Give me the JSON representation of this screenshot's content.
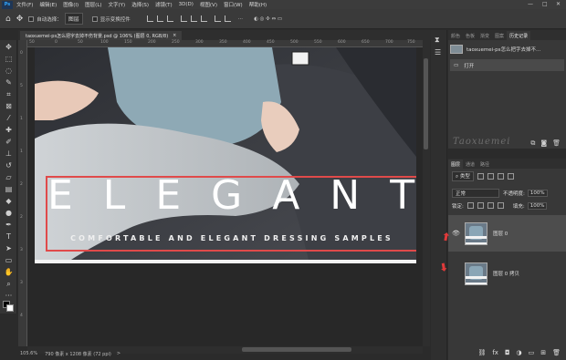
{
  "menubar": {
    "logo": "Ps",
    "items": [
      "文件(F)",
      "编辑(E)",
      "图像(I)",
      "图层(L)",
      "文字(Y)",
      "选择(S)",
      "滤镜(T)",
      "3D(D)",
      "视图(V)",
      "窗口(W)",
      "帮助(H)"
    ],
    "minimize": "—",
    "restore": "□",
    "close": "✕"
  },
  "options": {
    "auto_select_label": "自动选择：",
    "auto_select_value": "图层",
    "show_transform_label": "显示变换控件",
    "more": "···"
  },
  "document": {
    "tab_label": "taoxuemei-ps怎么把字去掉不伤背景.psd @ 106% (图层 0, RGB/8)",
    "close": "×",
    "title_text": "ELEGANT",
    "subtitle_text": "COMFORTABLE AND ELEGANT DRESSING SAMPLES"
  },
  "ruler": {
    "top_ticks": [
      "50",
      "0",
      "50",
      "100",
      "150",
      "200",
      "250",
      "300",
      "350",
      "400",
      "450",
      "500",
      "550",
      "600",
      "650",
      "700",
      "750"
    ],
    "left_ticks": [
      "0",
      "5",
      "1",
      "1",
      "2",
      "2",
      "3",
      "3",
      "4"
    ]
  },
  "status": {
    "zoom": "105.6%",
    "doc_size": "790 像素 x 1208 像素 (72 ppi)",
    "arrow": ">"
  },
  "history": {
    "tabs": [
      "颜色",
      "色板",
      "渐变",
      "图案",
      "历史记录"
    ],
    "snapshot_label": "taoxuemei-ps怎么把字去掉不...",
    "step_label": "打开"
  },
  "watermark": "Taoxuemei",
  "layers": {
    "tabs": [
      "图层",
      "通道",
      "路径"
    ],
    "filter_label": "类型",
    "blend_mode": "正常",
    "opacity_label": "不透明度:",
    "opacity_value": "100%",
    "lock_label": "锁定:",
    "fill_label": "填充:",
    "fill_value": "100%",
    "items": [
      {
        "name": "图层 0"
      },
      {
        "name": "图层 0 拷贝"
      }
    ],
    "footer_icons": [
      "link-icon",
      "fx-icon",
      "mask-icon",
      "adjustment-icon",
      "group-icon",
      "new-layer-icon",
      "trash-icon"
    ]
  },
  "colors": {
    "red_annotation": "#e04a4a",
    "accent": "#31a8ff"
  }
}
